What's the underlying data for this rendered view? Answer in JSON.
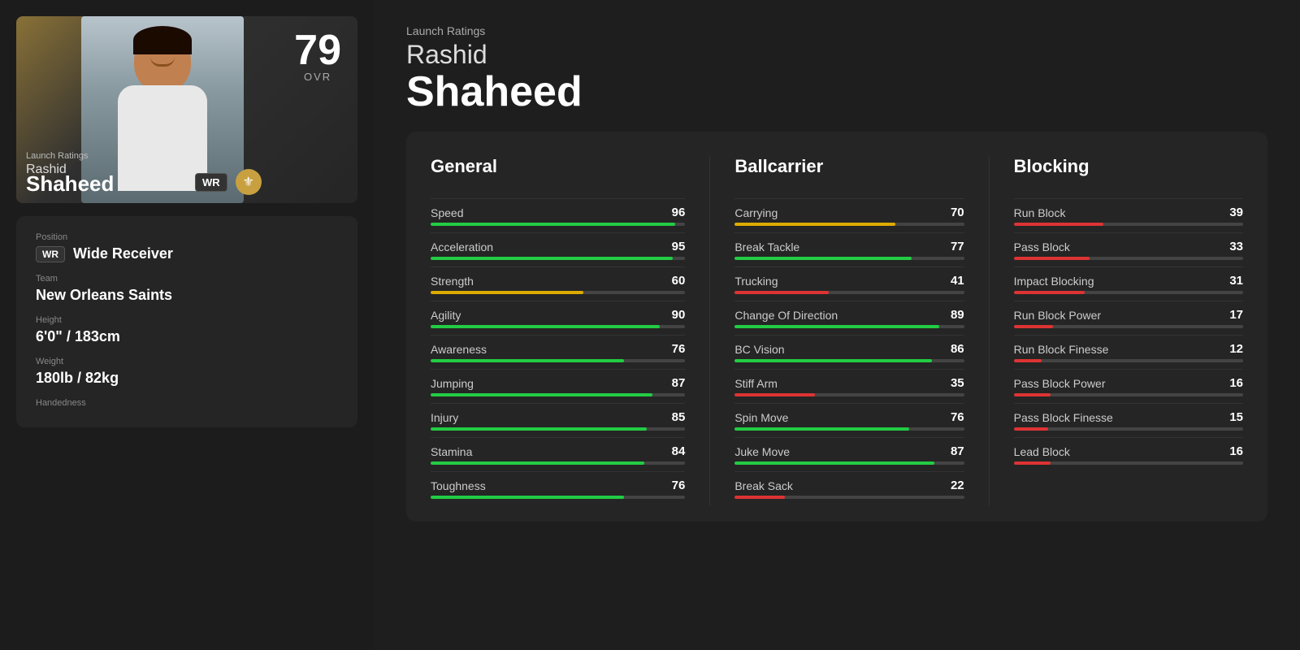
{
  "header": {
    "launch_label": "Launch Ratings",
    "first_name": "Rashid",
    "last_name": "Shaheed"
  },
  "player_card": {
    "ovr": "79",
    "ovr_label": "OVR",
    "launch_label": "Launch Ratings",
    "first_name": "Rashid",
    "last_name": "Shaheed",
    "position": "WR",
    "team_logo": "⚜"
  },
  "player_info": {
    "position_label": "Position",
    "position_badge": "WR",
    "position_value": "Wide Receiver",
    "team_label": "Team",
    "team_value": "New Orleans Saints",
    "height_label": "Height",
    "height_value": "6'0\" / 183cm",
    "weight_label": "Weight",
    "weight_value": "180lb / 82kg",
    "handedness_label": "Handedness"
  },
  "stats": {
    "general": {
      "header": "General",
      "items": [
        {
          "name": "Speed",
          "value": 96,
          "bar_pct": 96,
          "bar_color": "green"
        },
        {
          "name": "Acceleration",
          "value": 95,
          "bar_pct": 95,
          "bar_color": "green"
        },
        {
          "name": "Strength",
          "value": 60,
          "bar_pct": 60,
          "bar_color": "yellow"
        },
        {
          "name": "Agility",
          "value": 90,
          "bar_pct": 90,
          "bar_color": "green"
        },
        {
          "name": "Awareness",
          "value": 76,
          "bar_pct": 76,
          "bar_color": "green"
        },
        {
          "name": "Jumping",
          "value": 87,
          "bar_pct": 87,
          "bar_color": "green"
        },
        {
          "name": "Injury",
          "value": 85,
          "bar_pct": 85,
          "bar_color": "green"
        },
        {
          "name": "Stamina",
          "value": 84,
          "bar_pct": 84,
          "bar_color": "green"
        },
        {
          "name": "Toughness",
          "value": 76,
          "bar_pct": 76,
          "bar_color": "green"
        }
      ]
    },
    "ballcarrier": {
      "header": "Ballcarrier",
      "items": [
        {
          "name": "Carrying",
          "value": 70,
          "bar_pct": 70,
          "bar_color": "yellow"
        },
        {
          "name": "Break Tackle",
          "value": 77,
          "bar_pct": 77,
          "bar_color": "green"
        },
        {
          "name": "Trucking",
          "value": 41,
          "bar_pct": 41,
          "bar_color": "red"
        },
        {
          "name": "Change Of Direction",
          "value": 89,
          "bar_pct": 89,
          "bar_color": "green"
        },
        {
          "name": "BC Vision",
          "value": 86,
          "bar_pct": 86,
          "bar_color": "green"
        },
        {
          "name": "Stiff Arm",
          "value": 35,
          "bar_pct": 35,
          "bar_color": "red"
        },
        {
          "name": "Spin Move",
          "value": 76,
          "bar_pct": 76,
          "bar_color": "green"
        },
        {
          "name": "Juke Move",
          "value": 87,
          "bar_pct": 87,
          "bar_color": "green"
        },
        {
          "name": "Break Sack",
          "value": 22,
          "bar_pct": 22,
          "bar_color": "red"
        }
      ]
    },
    "blocking": {
      "header": "Blocking",
      "items": [
        {
          "name": "Run Block",
          "value": 39,
          "bar_pct": 39,
          "bar_color": "red"
        },
        {
          "name": "Pass Block",
          "value": 33,
          "bar_pct": 33,
          "bar_color": "red"
        },
        {
          "name": "Impact Blocking",
          "value": 31,
          "bar_pct": 31,
          "bar_color": "red"
        },
        {
          "name": "Run Block Power",
          "value": 17,
          "bar_pct": 17,
          "bar_color": "red"
        },
        {
          "name": "Run Block Finesse",
          "value": 12,
          "bar_pct": 12,
          "bar_color": "red"
        },
        {
          "name": "Pass Block Power",
          "value": 16,
          "bar_pct": 16,
          "bar_color": "red"
        },
        {
          "name": "Pass Block Finesse",
          "value": 15,
          "bar_pct": 15,
          "bar_color": "red"
        },
        {
          "name": "Lead Block",
          "value": 16,
          "bar_pct": 16,
          "bar_color": "red"
        }
      ]
    }
  }
}
